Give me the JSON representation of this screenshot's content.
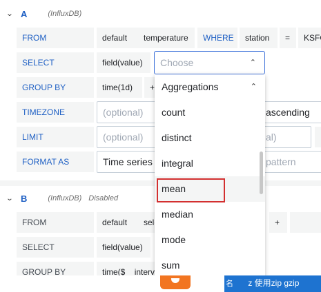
{
  "query_a": {
    "letter": "A",
    "source": "(InfluxDB)",
    "from": {
      "label": "FROM",
      "policy": "default",
      "measurement": "temperature",
      "where": "WHERE",
      "tag": "station",
      "op": "=",
      "value": "KSFO"
    },
    "select": {
      "label": "SELECT",
      "field": "field(value)",
      "choose_placeholder": "Choose"
    },
    "group_by": {
      "label": "GROUP BY",
      "time": "time(1d)",
      "plus": "+"
    },
    "timezone": {
      "label": "TIMEZONE",
      "placeholder": "(optional)",
      "order": "ascending"
    },
    "limit": {
      "label": "LIMIT",
      "placeholder": "(optional)",
      "slimit_placeholder": "al)"
    },
    "format_as": {
      "label": "FORMAT AS",
      "value": "Time series",
      "alias_placeholder": "pattern"
    }
  },
  "query_b": {
    "letter": "B",
    "source": "(InfluxDB)",
    "status": "Disabled",
    "from": {
      "label": "FROM",
      "policy": "default",
      "partial": "sele",
      "plus": "+"
    },
    "select": {
      "label": "SELECT",
      "field": "field(value)"
    },
    "group_by": {
      "label": "GROUP BY",
      "time": "time($__interv"
    }
  },
  "dropdown": {
    "header": "Aggregations",
    "items": [
      "count",
      "distinct",
      "integral",
      "mean",
      "median",
      "mode",
      "sum"
    ],
    "highlighted": "mean"
  },
  "taskbar": {
    "text": "z  使用zip gzip",
    "prefix": "名"
  },
  "colors": {
    "accent": "#1f60c4",
    "highlight": "#d32f2f",
    "taskbar_blue": "#1e73d0",
    "orange": "#f27521"
  }
}
